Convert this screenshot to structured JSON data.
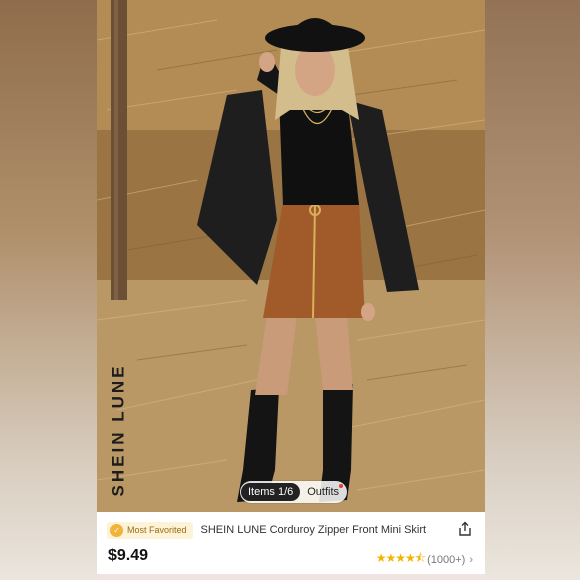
{
  "product": {
    "brand_watermark": "SHEIN LUNE",
    "image_pager": {
      "items_label": "Items 1/6",
      "outfits_label": "Outfits"
    },
    "badge": {
      "label": "Most Favorited",
      "icon": "medal-icon"
    },
    "title": "SHEIN LUNE Corduroy Zipper Front Mini Skirt",
    "price": "$9.49",
    "rating": {
      "stars": 4.5,
      "stars_glyphs": "★★★★⯪",
      "count": "(1000+)"
    },
    "share_icon": "share-icon"
  },
  "colors": {
    "badge_bg": "#fdf3d6",
    "badge_text": "#9a6a17",
    "star": "#f4b400"
  }
}
